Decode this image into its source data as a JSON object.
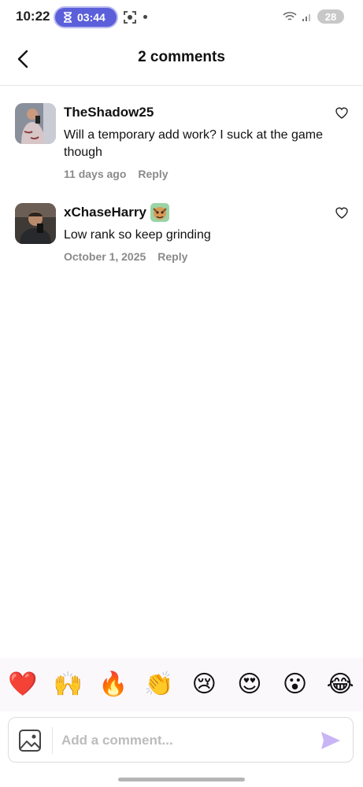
{
  "status_bar": {
    "time": "10:22",
    "timer": "03:44",
    "battery": "28"
  },
  "header": {
    "title": "2 comments"
  },
  "comments": [
    {
      "username": "TheShadow25",
      "text": "Will a temporary add work? I suck at the game though",
      "time": "11 days ago",
      "reply_label": "Reply"
    },
    {
      "username": "xChaseHarry",
      "text": "Low rank so keep grinding",
      "time": "October 1, 2025",
      "reply_label": "Reply"
    }
  ],
  "emoji_bar": [
    "❤️",
    "🙌",
    "🔥",
    "👏",
    "😢",
    "😍",
    "😮",
    "😂"
  ],
  "composer": {
    "placeholder": "Add a comment..."
  },
  "colors": {
    "accent": "#5b5fd9",
    "send": "#c9b5f5",
    "meta": "#8a8a8a"
  }
}
